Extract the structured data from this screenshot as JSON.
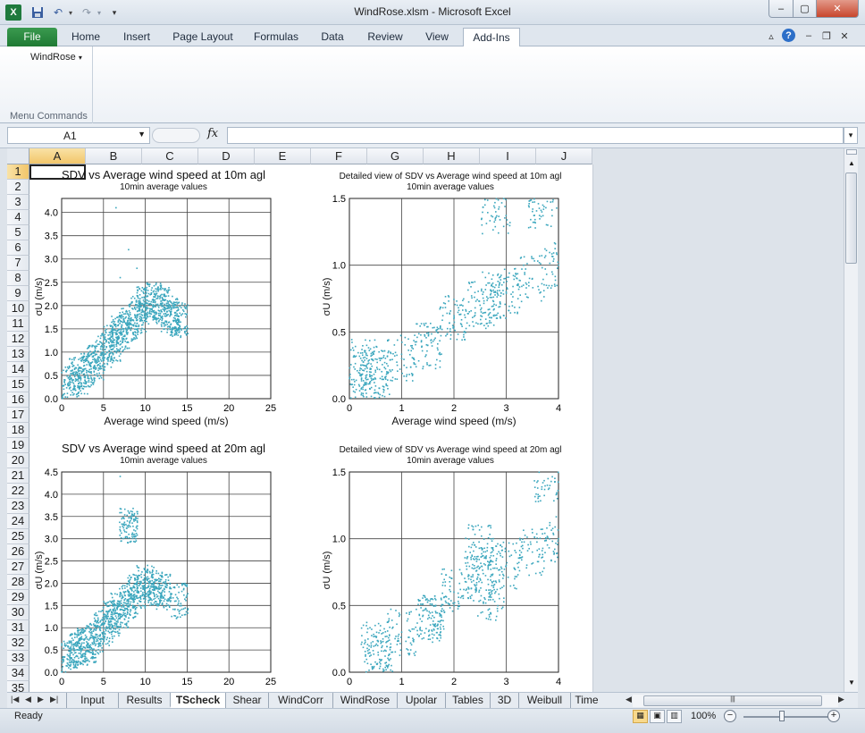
{
  "window": {
    "title": "WindRose.xlsm  -  Microsoft Excel"
  },
  "qat": {
    "undo_arrow": "▾",
    "redo_arrow": "▾",
    "customize": "▾"
  },
  "ribbon": {
    "tabs": [
      "File",
      "Home",
      "Insert",
      "Page Layout",
      "Formulas",
      "Data",
      "Review",
      "View",
      "Add-Ins"
    ],
    "active_tab": "Add-Ins",
    "menu_item": "WindRose",
    "group_name": "Menu Commands"
  },
  "formula_bar": {
    "name_box": "A1",
    "fx": "fx",
    "formula": ""
  },
  "columns": [
    "A",
    "B",
    "C",
    "D",
    "E",
    "F",
    "G",
    "H",
    "I",
    "J"
  ],
  "rows": [
    "1",
    "2",
    "3",
    "4",
    "5",
    "6",
    "7",
    "8",
    "9",
    "10",
    "11",
    "12",
    "13",
    "14",
    "15",
    "16",
    "17",
    "18",
    "19",
    "20",
    "21",
    "22",
    "23",
    "24",
    "25",
    "26",
    "27",
    "28",
    "29",
    "30",
    "31",
    "32",
    "33",
    "34",
    "35"
  ],
  "selected_cell": "A1",
  "charts": [
    {
      "title": "SDV vs Average wind speed at 10m agl",
      "subtitle": "10min average values",
      "xlabel": "Average wind speed (m/s)",
      "ylabel": "σU (m/s)",
      "xticks": [
        "0",
        "5",
        "10",
        "15",
        "20",
        "25"
      ],
      "yticks": [
        "0.0",
        "0.5",
        "1.0",
        "1.5",
        "2.0",
        "2.5",
        "3.0",
        "3.5",
        "4.0"
      ]
    },
    {
      "title": "Detailed view of SDV vs Average wind speed at 10m agl",
      "subtitle": "10min average values",
      "xlabel": "Average wind speed (m/s)",
      "ylabel": "σU (m/s)",
      "xticks": [
        "0",
        "1",
        "2",
        "3",
        "4"
      ],
      "yticks": [
        "0.0",
        "0.5",
        "1.0",
        "1.5"
      ]
    },
    {
      "title": "SDV vs Average wind speed at 20m agl",
      "subtitle": "10min average values",
      "xlabel": "",
      "ylabel": "σU (m/s)",
      "xticks": [
        "0",
        "5",
        "10",
        "15",
        "20",
        "25"
      ],
      "yticks": [
        "0.0",
        "0.5",
        "1.0",
        "1.5",
        "2.0",
        "2.5",
        "3.0",
        "3.5",
        "4.0",
        "4.5"
      ]
    },
    {
      "title": "Detailed view of SDV vs Average wind speed at 20m agl",
      "subtitle": "10min average values",
      "xlabel": "",
      "ylabel": "σU (m/s)",
      "xticks": [
        "0",
        "1",
        "2",
        "3",
        "4"
      ],
      "yticks": [
        "0.0",
        "0.5",
        "1.0",
        "1.5"
      ]
    }
  ],
  "chart_data": [
    {
      "type": "scatter",
      "title": "SDV vs Average wind speed at 10m agl",
      "subtitle": "10min average values",
      "xlabel": "Average wind speed (m/s)",
      "ylabel": "σU (m/s)",
      "xlim": [
        0,
        25
      ],
      "ylim": [
        0,
        4.3
      ],
      "grid": true,
      "color": "#3aa6bd",
      "series": [
        {
          "points": [
            [
              1,
              0.3
            ],
            [
              2,
              0.5
            ],
            [
              3,
              0.6
            ],
            [
              4,
              0.8
            ],
            [
              5,
              1.0
            ],
            [
              6,
              1.2
            ],
            [
              7,
              1.4
            ],
            [
              8,
              1.6
            ],
            [
              9,
              1.8
            ],
            [
              10,
              2.0
            ],
            [
              11,
              2.1
            ],
            [
              12,
              2.0
            ],
            [
              13,
              1.8
            ],
            [
              14,
              1.7
            ],
            [
              7,
              2.6
            ],
            [
              9,
              2.8
            ],
            [
              8,
              3.2
            ],
            [
              6.5,
              4.1
            ]
          ]
        }
      ]
    },
    {
      "type": "scatter",
      "title": "Detailed view of SDV vs Average wind speed at 10m agl",
      "subtitle": "10min average values",
      "xlabel": "Average wind speed (m/s)",
      "ylabel": "σU (m/s)",
      "xlim": [
        0,
        4
      ],
      "ylim": [
        0,
        1.5
      ],
      "grid": true,
      "color": "#3aa6bd",
      "series": [
        {
          "points": [
            [
              0.5,
              0.2
            ],
            [
              1,
              0.3
            ],
            [
              1.5,
              0.4
            ],
            [
              2,
              0.6
            ],
            [
              2.5,
              0.7
            ],
            [
              3,
              0.8
            ],
            [
              3.5,
              0.9
            ],
            [
              4,
              1.0
            ],
            [
              2.8,
              1.4
            ],
            [
              3.7,
              1.45
            ]
          ]
        }
      ]
    },
    {
      "type": "scatter",
      "title": "SDV vs Average wind speed at 20m agl",
      "subtitle": "10min average values",
      "xlabel": "",
      "ylabel": "σU (m/s)",
      "xlim": [
        0,
        25
      ],
      "ylim": [
        0,
        4.5
      ],
      "grid": true,
      "color": "#3aa6bd",
      "series": [
        {
          "points": [
            [
              1,
              0.3
            ],
            [
              2,
              0.5
            ],
            [
              3,
              0.6
            ],
            [
              4,
              0.8
            ],
            [
              5,
              1.0
            ],
            [
              6,
              1.2
            ],
            [
              7,
              1.4
            ],
            [
              8,
              1.6
            ],
            [
              9,
              1.8
            ],
            [
              10,
              2.0
            ],
            [
              11,
              1.9
            ],
            [
              12,
              1.8
            ],
            [
              14,
              1.6
            ],
            [
              8,
              3.3
            ],
            [
              7,
              4.4
            ]
          ]
        }
      ]
    },
    {
      "type": "scatter",
      "title": "Detailed view of SDV vs Average wind speed at 20m agl",
      "subtitle": "10min average values",
      "xlabel": "",
      "ylabel": "σU (m/s)",
      "xlim": [
        0,
        4
      ],
      "ylim": [
        0,
        1.5
      ],
      "grid": true,
      "color": "#3aa6bd",
      "series": [
        {
          "points": [
            [
              0.5,
              0.2
            ],
            [
              1,
              0.3
            ],
            [
              1.5,
              0.4
            ],
            [
              2,
              0.6
            ],
            [
              2.5,
              0.7
            ],
            [
              3,
              0.8
            ],
            [
              3.5,
              0.9
            ],
            [
              4,
              1.0
            ],
            [
              3.8,
              1.45
            ]
          ]
        }
      ]
    }
  ],
  "sheet_tabs": [
    "Input",
    "Results",
    "TScheck",
    "Shear",
    "WindCorr",
    "WindRose",
    "Upolar",
    "Tables",
    "3D",
    "Weibull",
    "Time"
  ],
  "active_sheet": "TScheck",
  "status": {
    "ready": "Ready",
    "zoom": "100%",
    "zoom_level": 100
  }
}
